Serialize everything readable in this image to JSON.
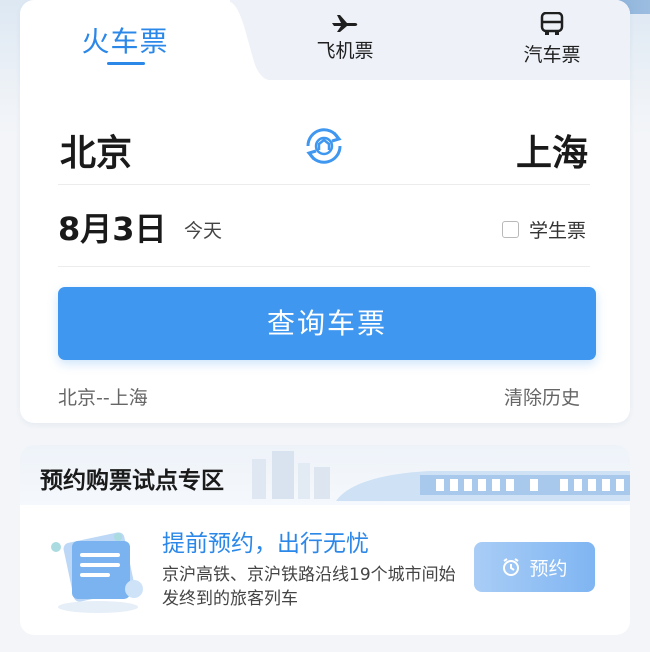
{
  "tabs": {
    "train": "火车票",
    "flight": "飞机票",
    "bus": "汽车票"
  },
  "route": {
    "from": "北京",
    "to": "上海"
  },
  "date": {
    "value": "8月3日",
    "relative": "今天"
  },
  "student_ticket_label": "学生票",
  "search_button": "查询车票",
  "history": {
    "item": "北京--上海",
    "clear_label": "清除历史"
  },
  "promo": {
    "section_title": "预约购票试点专区",
    "headline": "提前预约，出行无忧",
    "description": "京沪高铁、京沪铁路沿线19个城市间始发终到的旅客列车",
    "button_label": "预约"
  },
  "colors": {
    "accent": "#2c88e8",
    "button": "#3f97f0"
  },
  "icons": {
    "flight": "airplane-icon",
    "bus": "bus-icon",
    "swap": "swap-stations-icon",
    "reserve": "alarm-clock-icon",
    "promo": "document-calendar-icon"
  }
}
